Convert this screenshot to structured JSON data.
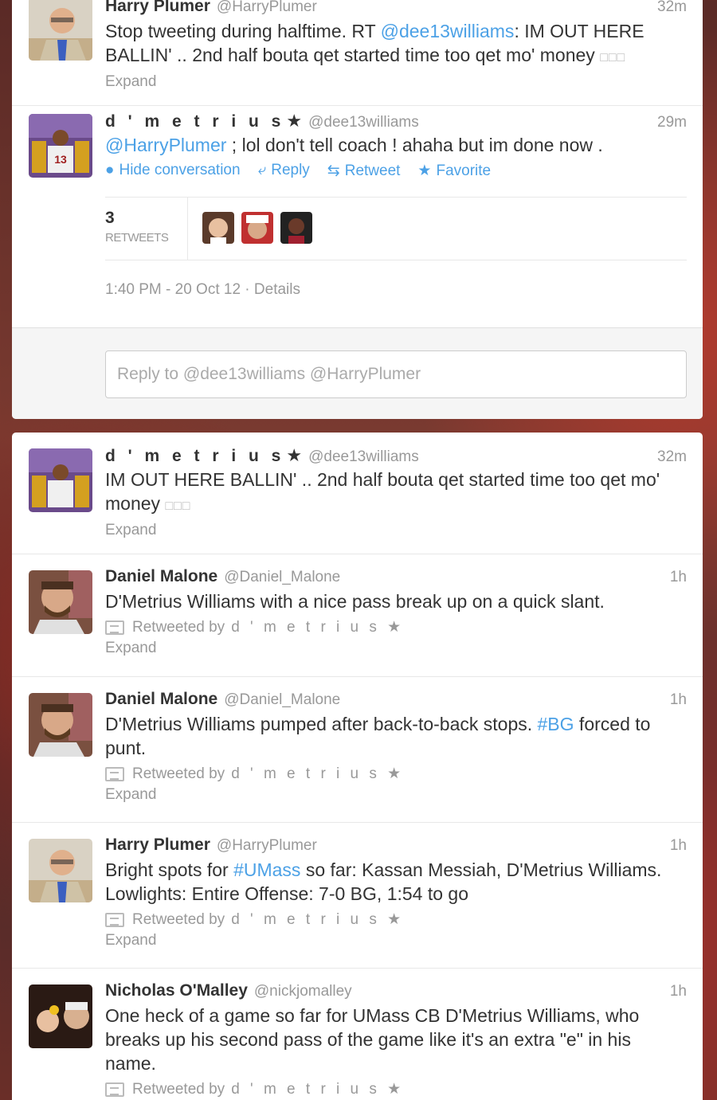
{
  "tweets_top": [
    {
      "name": "Harry Plumer",
      "handle": "@HarryPlumer",
      "time": "32m",
      "text_pre": "Stop tweeting during halftime. RT ",
      "text_link": "@dee13williams",
      "text_post": ": IM OUT HERE BALLIN' .. 2nd half bouta qet started time too qet mo' money",
      "boxes": "□□□",
      "expand": "Expand"
    },
    {
      "name": "d ' m e t r i u s",
      "star": "★",
      "handle": "@dee13williams",
      "time": "29m",
      "text_link": "@HarryPlumer",
      "text_post": " ; lol don't tell coach ! ahaha but im done now .",
      "actions": {
        "hide": "Hide conversation",
        "reply": "Reply",
        "retweet": "Retweet",
        "favorite": "Favorite"
      },
      "retweets_count": "3",
      "retweets_label": "RETWEETS",
      "timestamp": "1:40 PM - 20 Oct 12",
      "details_sep": " · ",
      "details": "Details",
      "reply_placeholder": "Reply to @dee13williams @HarryPlumer"
    }
  ],
  "tweets_bottom": [
    {
      "name": "d ' m e t r i u s",
      "star": "★",
      "handle": "@dee13williams",
      "time": "32m",
      "text": "IM OUT HERE BALLIN' .. 2nd half bouta qet started time too qet mo' money",
      "boxes": "□□□",
      "expand": "Expand"
    },
    {
      "name": "Daniel Malone",
      "handle": "@Daniel_Malone",
      "time": "1h",
      "text": "D'Metrius Williams with a nice pass break up on a quick slant.",
      "retweeted_by": "Retweeted by",
      "retweeter": "d ' m e t r i u s ★",
      "expand": "Expand"
    },
    {
      "name": "Daniel Malone",
      "handle": "@Daniel_Malone",
      "time": "1h",
      "text_pre": "D'Metrius Williams pumped after back-to-back stops. ",
      "text_link": "#BG",
      "text_post": " forced to punt.",
      "retweeted_by": "Retweeted by",
      "retweeter": "d ' m e t r i u s ★",
      "expand": "Expand"
    },
    {
      "name": "Harry Plumer",
      "handle": "@HarryPlumer",
      "time": "1h",
      "text_pre": "Bright spots for ",
      "text_link": "#UMass",
      "text_post": " so far: Kassan Messiah, D'Metrius Williams. Lowlights: Entire Offense: 7-0 BG, 1:54 to go",
      "retweeted_by": "Retweeted by",
      "retweeter": "d ' m e t r i u s ★",
      "expand": "Expand"
    },
    {
      "name": "Nicholas O'Malley",
      "handle": "@nickjomalley",
      "time": "1h",
      "text": "One heck of a game so far for UMass CB D'Metrius Williams, who breaks up his second pass of the game like it's an extra \"e\" in his name.",
      "retweeted_by": "Retweeted by",
      "retweeter": "d ' m e t r i u s ★"
    }
  ],
  "icons": {
    "hide": "speech-bubble-icon",
    "reply": "reply-arrow-icon",
    "retweet": "retweet-icon",
    "favorite": "star-icon",
    "retweeted": "retweet-box-icon"
  },
  "colors": {
    "link": "#4ca1e6",
    "muted": "#999999",
    "text": "#333333"
  }
}
